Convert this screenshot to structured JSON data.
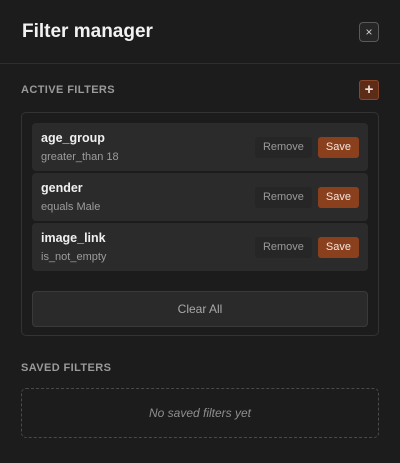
{
  "header": {
    "title": "Filter manager",
    "close_label": "×"
  },
  "active": {
    "label": "ACTIVE FILTERS",
    "add_label": "+",
    "filters": [
      {
        "name": "age_group",
        "condition": "greater_than 18",
        "remove_label": "Remove",
        "save_label": "Save"
      },
      {
        "name": "gender",
        "condition": "equals Male",
        "remove_label": "Remove",
        "save_label": "Save"
      },
      {
        "name": "image_link",
        "condition": "is_not_empty",
        "remove_label": "Remove",
        "save_label": "Save"
      }
    ],
    "clear_label": "Clear All"
  },
  "saved": {
    "label": "SAVED FILTERS",
    "empty_text": "No saved filters yet"
  },
  "colors": {
    "background": "#1c1c1c",
    "accent": "#8a3f1d",
    "row": "#2b2b2b"
  }
}
